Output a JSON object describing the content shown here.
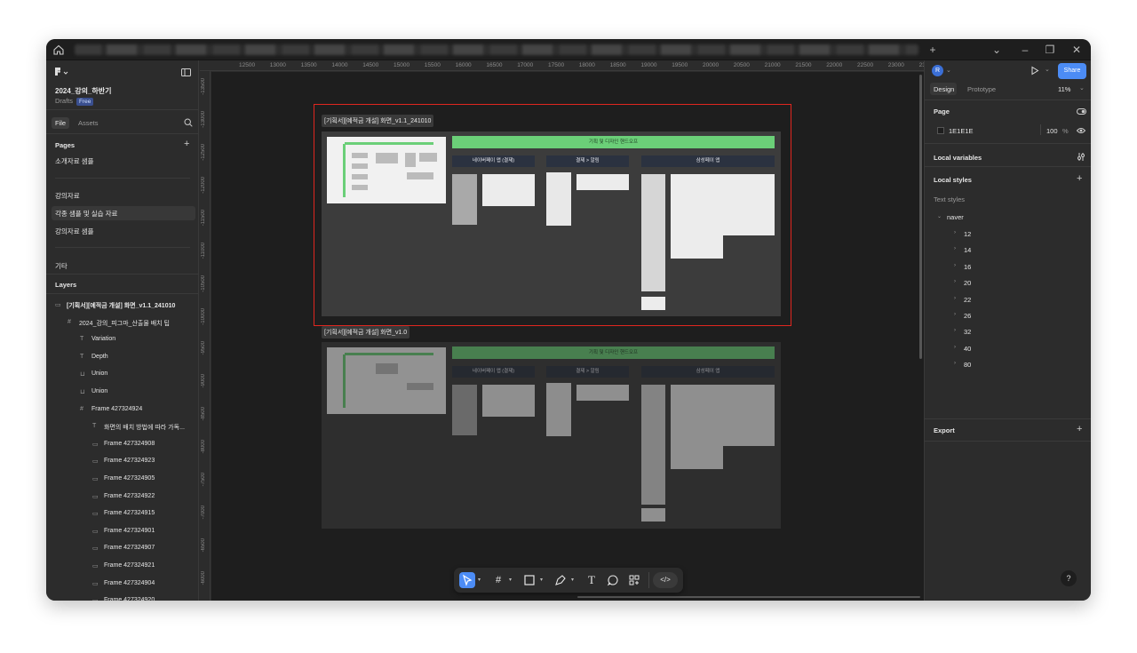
{
  "file": {
    "name": "2024_강의_하반기",
    "location": "Drafts",
    "plan": "Free"
  },
  "left_tabs": {
    "file": "File",
    "assets": "Assets"
  },
  "pages": {
    "header": "Pages",
    "items": [
      "소개자료 샘플",
      "강의자료",
      "각종 샘플 및 실습 자료",
      "강의자료 샘플",
      "기타"
    ]
  },
  "layers": {
    "header": "Layers",
    "items": [
      {
        "icon": "frame-icon",
        "label": "[기획서][예적금 개설] 화면_v1.1_241010"
      },
      {
        "icon": "grid-icon",
        "label": "2024_강의_피그마_산출물 배치 팁"
      },
      {
        "icon": "text-icon",
        "label": "Variation"
      },
      {
        "icon": "text-icon",
        "label": "Depth"
      },
      {
        "icon": "union-icon",
        "label": "Union"
      },
      {
        "icon": "union-icon",
        "label": "Union"
      },
      {
        "icon": "grid-icon",
        "label": "Frame 427324924"
      },
      {
        "icon": "text-icon",
        "label": "화면의 배치 방법에 따라 가독..."
      },
      {
        "icon": "frame-icon",
        "label": "Frame 427324908"
      },
      {
        "icon": "frame-icon",
        "label": "Frame 427324923"
      },
      {
        "icon": "frame-icon",
        "label": "Frame 427324905"
      },
      {
        "icon": "frame-icon",
        "label": "Frame 427324922"
      },
      {
        "icon": "frame-icon",
        "label": "Frame 427324915"
      },
      {
        "icon": "frame-icon",
        "label": "Frame 427324901"
      },
      {
        "icon": "frame-icon",
        "label": "Frame 427324907"
      },
      {
        "icon": "frame-icon",
        "label": "Frame 427324921"
      },
      {
        "icon": "frame-icon",
        "label": "Frame 427324904"
      },
      {
        "icon": "frame-icon",
        "label": "Frame 427324920"
      }
    ]
  },
  "ruler": {
    "top": [
      "12500",
      "13000",
      "13500",
      "14000",
      "14500",
      "15000",
      "15500",
      "16000",
      "16500",
      "17000",
      "17500",
      "18000",
      "18500",
      "19000",
      "19500",
      "20000",
      "20500",
      "21000",
      "21500",
      "22000",
      "22500",
      "23000",
      "23"
    ],
    "left": [
      "-13500",
      "-13000",
      "-12500",
      "-12000",
      "-11500",
      "-11000",
      "-10500",
      "-10000",
      "-9500",
      "-9000",
      "-8500",
      "-8000",
      "-7500",
      "-7000",
      "-6500",
      "-6000"
    ]
  },
  "canvas": {
    "frame1": {
      "label": "[기획서][예적금 개설] 화면_v1.1_241010",
      "banner": "기획 및 디자인 핸드오프",
      "sections": [
        "네이버페이 앱 (결제)",
        "결제 > 알림",
        "삼성페이 앱"
      ]
    },
    "frame2": {
      "label": "[기획서][예적금 개설] 화면_v1.0",
      "banner": "기획 및 디자인 핸드오프",
      "sections": [
        "네이버페이 앱 (결제)",
        "결제 > 알림",
        "삼성페이 앱"
      ]
    }
  },
  "toolbar": {
    "tools": [
      "move-tool",
      "frame-tool",
      "shape-tool",
      "pen-tool",
      "text-tool",
      "comment-tool",
      "actions-tool",
      "dev-mode-toggle"
    ]
  },
  "right": {
    "avatar_initial": "R",
    "share_label": "Share",
    "tabs": {
      "design": "Design",
      "prototype": "Prototype"
    },
    "zoom": "11%",
    "page": {
      "header": "Page",
      "bg_color_hex": "1E1E1E",
      "opacity": "100",
      "opacity_unit": "%"
    },
    "local_variables": "Local variables",
    "local_styles": "Local styles",
    "text_styles": "Text styles",
    "style_group": "naver",
    "style_items": [
      "12",
      "14",
      "16",
      "20",
      "22",
      "26",
      "32",
      "40",
      "80"
    ],
    "export": "Export",
    "help": "?"
  },
  "colors": {
    "accent": "#4c8cf5",
    "selection": "#e0261f",
    "banner_green": "#6bcf78",
    "canvas_bg": "#1e1e1e"
  }
}
